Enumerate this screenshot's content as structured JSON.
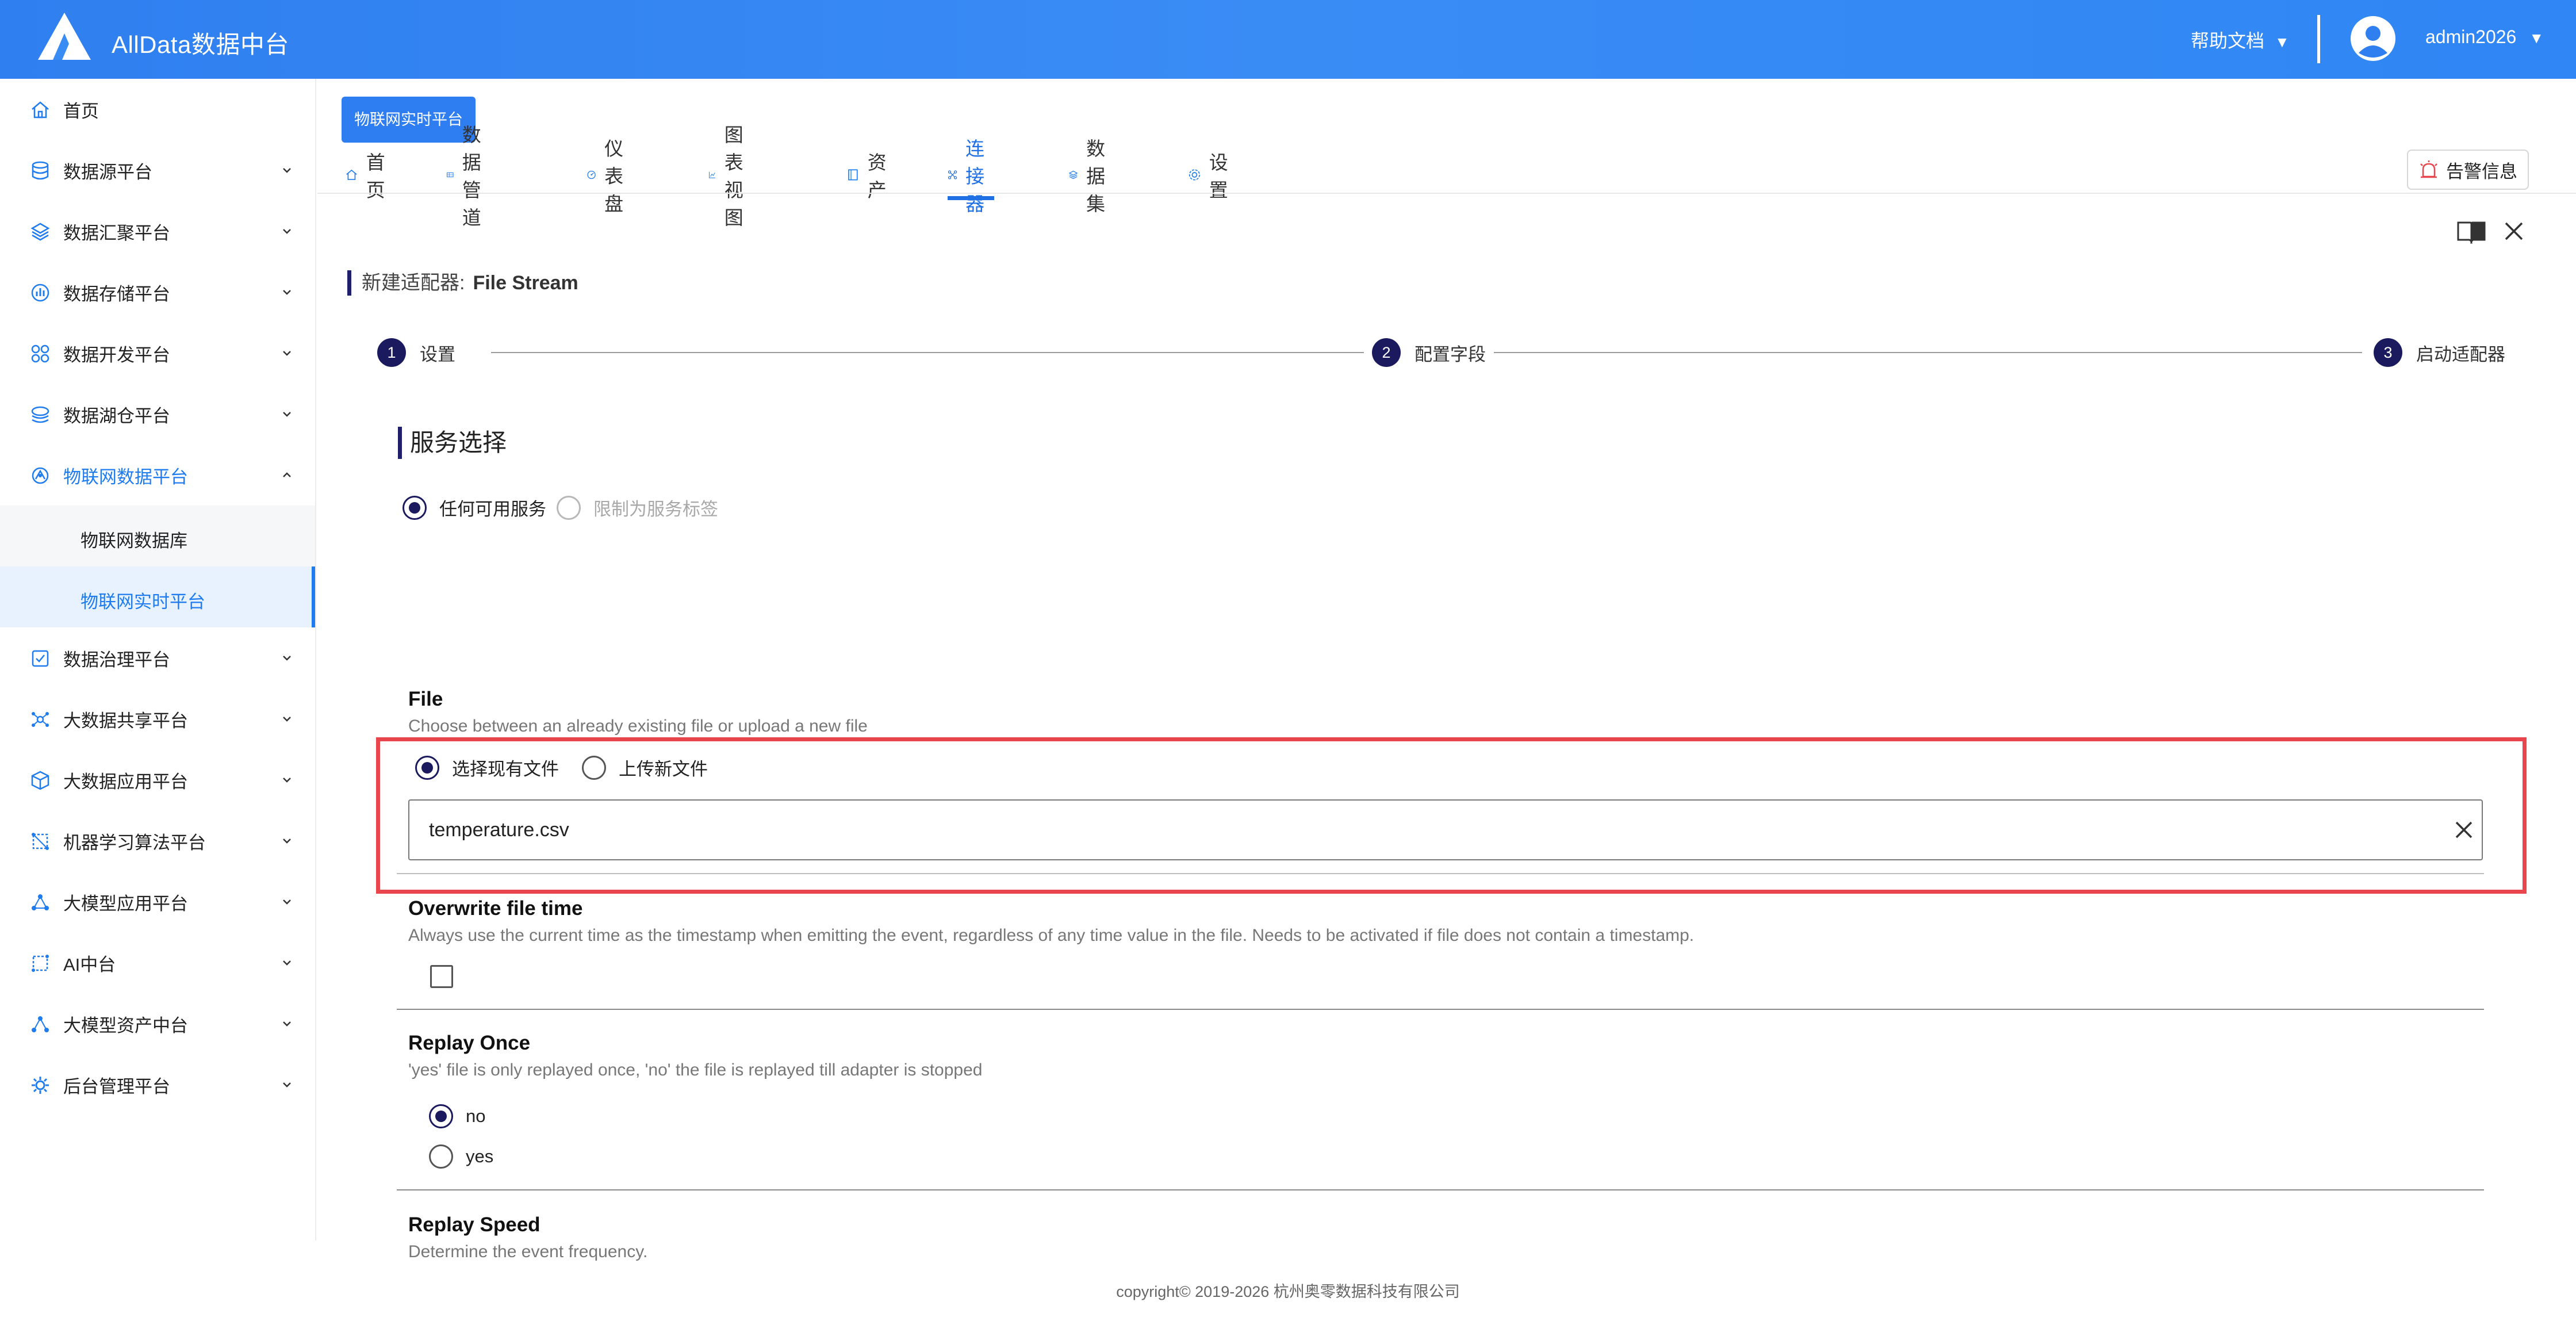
{
  "header": {
    "app_title": "AllData数据中台",
    "help_label": "帮助文档",
    "user_name": "admin2026",
    "caret": "▼"
  },
  "sidebar": {
    "items": [
      {
        "label": "首页",
        "icon": "home-icon"
      },
      {
        "label": "数据源平台",
        "icon": "database-icon"
      },
      {
        "label": "数据汇聚平台",
        "icon": "layers-icon"
      },
      {
        "label": "数据存储平台",
        "icon": "storage-icon"
      },
      {
        "label": "数据开发平台",
        "icon": "grid-icon"
      },
      {
        "label": "数据湖仓平台",
        "icon": "lake-icon"
      },
      {
        "label": "物联网数据平台",
        "icon": "iot-icon"
      },
      {
        "label": "数据治理平台",
        "icon": "governance-icon"
      },
      {
        "label": "大数据共享平台",
        "icon": "share-icon"
      },
      {
        "label": "大数据应用平台",
        "icon": "cube-icon"
      },
      {
        "label": "机器学习算法平台",
        "icon": "ml-icon"
      },
      {
        "label": "大模型应用平台",
        "icon": "model-icon"
      },
      {
        "label": "AI中台",
        "icon": "ai-icon"
      },
      {
        "label": "大模型资产中台",
        "icon": "asset-icon"
      },
      {
        "label": "后台管理平台",
        "icon": "admin-icon"
      }
    ],
    "sub_items": [
      {
        "label": "物联网数据库"
      },
      {
        "label": "物联网实时平台"
      }
    ]
  },
  "main": {
    "crumb_tag": "物联网实时平台",
    "tabs": [
      {
        "label": "首页",
        "icon": "home-icon"
      },
      {
        "label": "数据管道",
        "icon": "pipeline-icon"
      },
      {
        "label": "仪表盘",
        "icon": "dashboard-icon"
      },
      {
        "label": "图表视图",
        "icon": "chart-icon"
      },
      {
        "label": "资产",
        "icon": "asset-icon"
      },
      {
        "label": "连接器",
        "icon": "connector-icon"
      },
      {
        "label": "数据集",
        "icon": "dataset-icon"
      },
      {
        "label": "设置",
        "icon": "settings-icon"
      }
    ],
    "alert_label": "告警信息",
    "page_title_prefix": "新建适配器:",
    "page_title_name": "File Stream",
    "steps": [
      {
        "num": "1",
        "label": "设置"
      },
      {
        "num": "2",
        "label": "配置字段"
      },
      {
        "num": "3",
        "label": "启动适配器"
      }
    ],
    "service_section_title": "服务选择",
    "service_options": [
      {
        "label": "任何可用服务",
        "checked": true
      },
      {
        "label": "限制为服务标签",
        "checked": false
      }
    ],
    "file_field": {
      "label": "File",
      "description": "Choose between an already existing file or upload a new file",
      "options": [
        {
          "label": "选择现有文件"
        },
        {
          "label": "上传新文件"
        }
      ],
      "value": "temperature.csv"
    },
    "overwrite_field": {
      "label": "Overwrite file time",
      "description": "Always use the current time as the timestamp when emitting the event, regardless of any time value in the file. Needs to be activated if file does not contain a timestamp."
    },
    "replay_once_field": {
      "label": "Replay Once",
      "description": "'yes' file is only replayed once, 'no' the file is replayed till adapter is stopped",
      "options": [
        {
          "label": "no"
        },
        {
          "label": "yes"
        }
      ]
    },
    "replay_speed_field": {
      "label": "Replay Speed",
      "description": "Determine the event frequency."
    }
  },
  "footer": {
    "copyright": "copyright© 2019-2026 杭州奥零数据科技有限公司"
  },
  "colors": {
    "accent": "#1f7cf0",
    "header_bg": "#3a8cf5",
    "step_dot": "#1b1a5e",
    "highlight": "#e8454c"
  }
}
